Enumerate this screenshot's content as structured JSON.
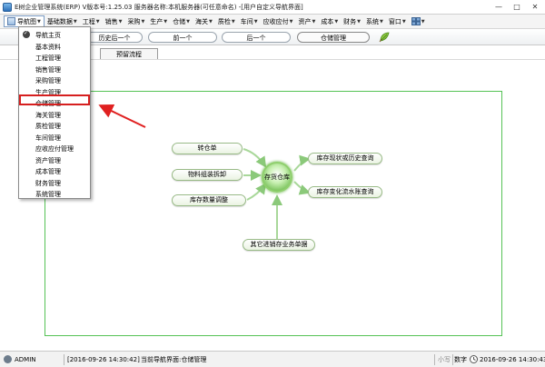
{
  "window": {
    "title": "E树企业管理系统(ERP)  V版本号:1.25.03  服务器名称:本机服务器(可任意命名)  -[用户自定义导航界面]",
    "buttons": [
      "—",
      "□",
      "✕"
    ]
  },
  "menubar": {
    "items": [
      {
        "label": "导航图",
        "dropdown": true,
        "active": true
      },
      {
        "label": "基础数据",
        "dropdown": true
      },
      {
        "label": "工程",
        "dropdown": true
      },
      {
        "label": "销售",
        "dropdown": true
      },
      {
        "label": "采购",
        "dropdown": true
      },
      {
        "label": "生产",
        "dropdown": true
      },
      {
        "label": "仓储",
        "dropdown": true
      },
      {
        "label": "海关",
        "dropdown": true
      },
      {
        "label": "质检",
        "dropdown": true
      },
      {
        "label": "车间",
        "dropdown": true
      },
      {
        "label": "应收应付",
        "dropdown": true
      },
      {
        "label": "资产",
        "dropdown": true
      },
      {
        "label": "成本",
        "dropdown": true
      },
      {
        "label": "财务",
        "dropdown": true
      },
      {
        "label": "系统",
        "dropdown": true
      },
      {
        "label": "窗口",
        "dropdown": true
      }
    ],
    "extra_icon": "window-tiles-icon"
  },
  "nav_tabs": [
    {
      "label": "历史后一个"
    },
    {
      "label": "前一个"
    },
    {
      "label": "后一个"
    },
    {
      "label": "仓储管理",
      "selected": true
    }
  ],
  "sub_tab": {
    "label": "预留流程"
  },
  "dropdown_menu": {
    "items": [
      {
        "label": "导航主页",
        "checked": true
      },
      {
        "label": "基本资料"
      },
      {
        "label": "工程管理"
      },
      {
        "label": "销售管理"
      },
      {
        "label": "采购管理"
      },
      {
        "label": "生产管理"
      },
      {
        "label": "仓储管理",
        "highlighted": true
      },
      {
        "label": "海关管理"
      },
      {
        "label": "质检管理"
      },
      {
        "label": "车间管理"
      },
      {
        "label": "应收应付管理"
      },
      {
        "label": "资产管理"
      },
      {
        "label": "成本管理"
      },
      {
        "label": "财务管理"
      },
      {
        "label": "系统管理"
      }
    ]
  },
  "flowchart": {
    "hub": "存货仓库",
    "left": [
      "转仓单",
      "物料组装拆卸",
      "库存数量调整"
    ],
    "right": [
      "库存现状或历史查询",
      "库存变化流水账查询"
    ],
    "bottom": "其它进销存业务单据"
  },
  "statusbar": {
    "user": "ADMIN",
    "login_time": "[2016-09-26 14:30:42]",
    "current_page": "当前导航界面:仓储管理",
    "caps": "小写",
    "numlock": "数字",
    "datetime": "2016-09-26 14:30:43"
  },
  "colors": {
    "highlight": "#d61f1f",
    "panel_border": "#55c255",
    "hub_green": "#4ea92b"
  }
}
